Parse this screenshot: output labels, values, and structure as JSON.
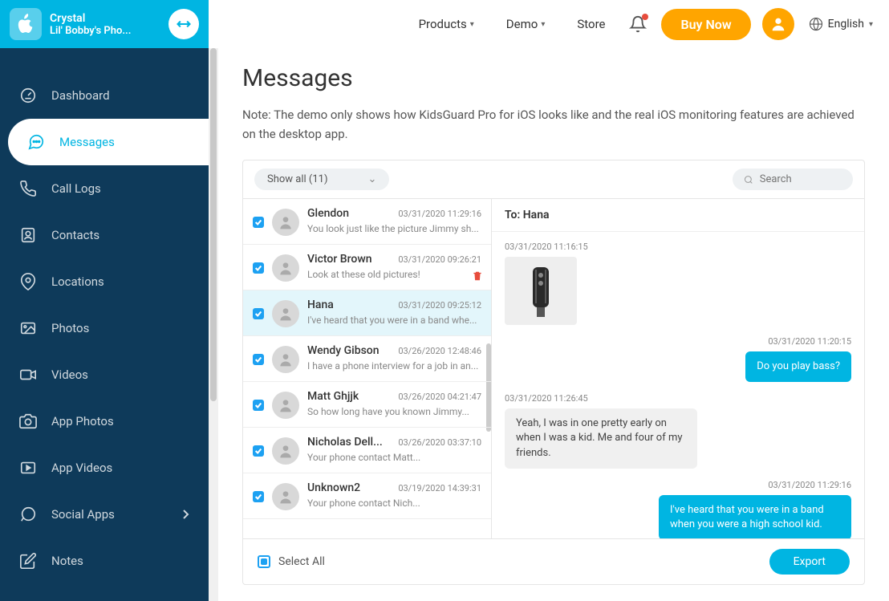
{
  "header": {
    "nav": {
      "products": "Products",
      "demo": "Demo",
      "store": "Store"
    },
    "buy": "Buy Now",
    "language": "English"
  },
  "device": {
    "name": "Crystal",
    "sub": "Lil' Bobby's Pho..."
  },
  "sidebar": {
    "items": [
      {
        "label": "Dashboard"
      },
      {
        "label": "Messages"
      },
      {
        "label": "Call Logs"
      },
      {
        "label": "Contacts"
      },
      {
        "label": "Locations"
      },
      {
        "label": "Photos"
      },
      {
        "label": "Videos"
      },
      {
        "label": "App Photos"
      },
      {
        "label": "App Videos"
      },
      {
        "label": "Social Apps"
      },
      {
        "label": "Notes"
      }
    ]
  },
  "page": {
    "title": "Messages",
    "note": "Note: The demo only shows how KidsGuard Pro for iOS looks like and the real iOS monitoring features are achieved on the desktop app.",
    "filter": "Show all (11)",
    "search_placeholder": "Search",
    "select_all": "Select All",
    "export": "Export"
  },
  "threads": [
    {
      "name": "Glendon",
      "time": "03/31/2020  11:29:16",
      "preview": "You look just like the picture Jimmy sh..."
    },
    {
      "name": "Victor Brown",
      "time": "03/31/2020  09:26:21",
      "preview": "Look at these old pictures!"
    },
    {
      "name": "Hana",
      "time": "03/31/2020  09:25:12",
      "preview": "I've heard that you were in a band whe..."
    },
    {
      "name": "Wendy Gibson",
      "time": "03/26/2020  12:48:46",
      "preview": "I have a phone interview for a job in an..."
    },
    {
      "name": "Matt Ghjjk",
      "time": "03/26/2020  04:21:47",
      "preview": "So how long have you known Jimmy..."
    },
    {
      "name": "Nicholas Dell...",
      "time": "03/26/2020  03:37:10",
      "preview": "Your phone contact Matt..."
    },
    {
      "name": "Unknown2",
      "time": "03/19/2020  14:39:31",
      "preview": "Your phone contact Nich..."
    }
  ],
  "chat": {
    "to": "To: Hana",
    "messages": [
      {
        "type": "recv",
        "time": "03/31/2020  11:16:15",
        "kind": "image"
      },
      {
        "type": "sent",
        "time": "03/31/2020  11:20:15",
        "text": "Do you play bass?"
      },
      {
        "type": "recv",
        "time": "03/31/2020  11:26:45",
        "text": "Yeah, I was in one pretty early on when I was a kid. Me and four of my friends."
      },
      {
        "type": "sent",
        "time": "03/31/2020  11:29:16",
        "text": "I've heard that you were in a band when you were a high school kid."
      }
    ]
  }
}
